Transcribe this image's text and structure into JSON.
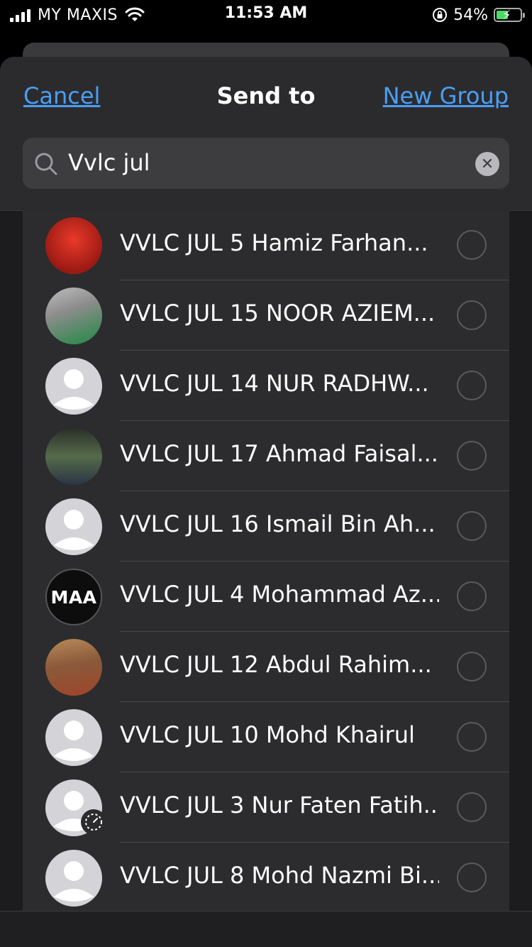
{
  "status_bar": {
    "carrier": "MY MAXIS",
    "time": "11:53 AM",
    "battery": "54%",
    "battery_level": 0.54
  },
  "header": {
    "cancel_label": "Cancel",
    "title": "Send to",
    "new_group_label": "New Group"
  },
  "search": {
    "value": "Vvlc jul",
    "icon": "search-icon",
    "clear_icon": "clear-icon"
  },
  "colors": {
    "accent": "#4a9ef5",
    "sheet_bg": "#1c1c1e",
    "list_bg": "#2c2c2e"
  },
  "contacts": [
    {
      "name": "VVLC JUL 5 Hamiz Farhan...",
      "avatar": "photo"
    },
    {
      "name": "VVLC JUL 15 NOOR AZIEM...",
      "avatar": "photo"
    },
    {
      "name": "VVLC JUL 14 NUR RADHW...",
      "avatar": "placeholder"
    },
    {
      "name": "VVLC JUL 17 Ahmad Faisal...",
      "avatar": "photo"
    },
    {
      "name": "VVLC JUL 16 Ismail Bin Ah...",
      "avatar": "placeholder"
    },
    {
      "name": "VVLC JUL 4 Mohammad Az...",
      "avatar": "logo",
      "avatar_text": "MAA"
    },
    {
      "name": "VVLC JUL 12 Abdul Rahim...",
      "avatar": "photo"
    },
    {
      "name": "VVLC JUL 10 Mohd Khairul",
      "avatar": "placeholder"
    },
    {
      "name": "VVLC JUL 3 Nur Faten Fatih...",
      "avatar": "placeholder",
      "badge": "timer-icon"
    },
    {
      "name": "VVLC JUL 8 Mohd Nazmi Bi...",
      "avatar": "placeholder"
    }
  ]
}
